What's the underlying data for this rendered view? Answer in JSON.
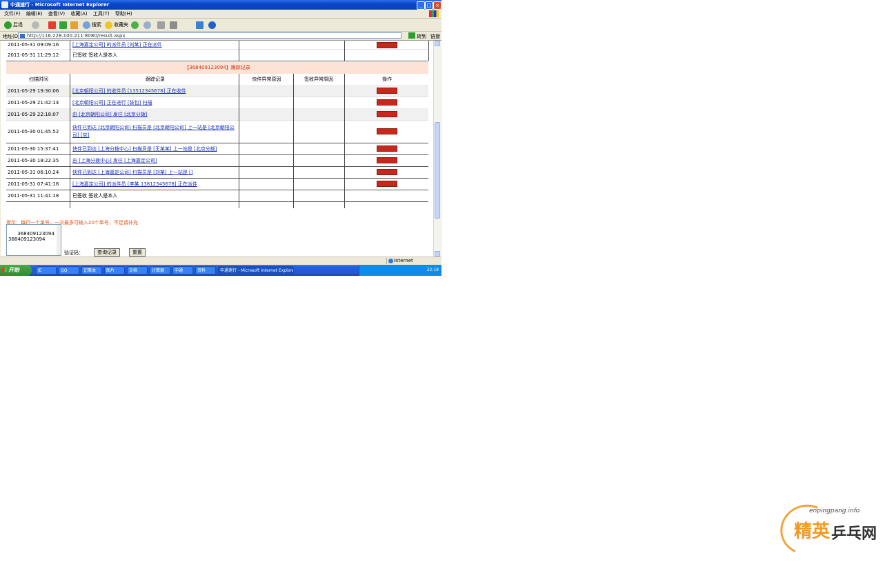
{
  "window": {
    "title": "中通速行 - Microsoft Internet Explorer",
    "controls": [
      "_",
      "□",
      "×"
    ]
  },
  "menu": [
    "文件(F)",
    "编辑(E)",
    "查看(V)",
    "收藏(A)",
    "工具(T)",
    "帮助(H)"
  ],
  "toolbar": {
    "back": "后退",
    "search": "搜索",
    "favorites": "收藏夹"
  },
  "address": {
    "label": "地址(D)",
    "url": "http://116.228.100.211:8080/result.aspx",
    "go": "转到",
    "links": "链接"
  },
  "top_rows": [
    {
      "time": "2011-05-31 09:09:16",
      "text": "[上海嘉定公司] 的派件员 [刘某] 正在派件"
    },
    {
      "time": "2011-05-31 11:29:12",
      "text": "已签收 签收人是本人"
    }
  ],
  "section_title": "【368409123094】跟踪记录",
  "headers": [
    "扫描时间",
    "跟踪记录",
    "快件异常原因",
    "签收异常原因",
    "操作"
  ],
  "rows": [
    {
      "time": "2011-05-29 19:30:06",
      "text": "[北京朝阳公司] 的收件员 [13512345678] 正在收件",
      "btn": "查看"
    },
    {
      "time": "2011-05-29 21:42:14",
      "text": "[北京朝阳公司] 正在进行 [装包] 扫描",
      "btn": "查看"
    },
    {
      "time": "2011-05-29 22:18:07",
      "text": "由 [北京朝阳公司] 发往 [北京分拨]",
      "btn": "查看"
    },
    {
      "time": "2011-05-30 01:45:52",
      "text": "快件已到达 [北京朝阳公司] 扫描员是 [北京朝阳公司] 上一站是 [北京朝阳公司] [空]",
      "btn": "查看"
    },
    {
      "time": "2011-05-30 15:37:41",
      "text": "快件已到达 [上海分拨中心] 扫描员是 [王某某] 上一站是 [北京分拨]",
      "btn": "查看"
    },
    {
      "time": "2011-05-30 18:22:35",
      "text": "由 [上海分拨中心] 发往 [上海嘉定公司]",
      "btn": "查看"
    },
    {
      "time": "2011-05-31 06:10:24",
      "text": "快件已到达 [上海嘉定公司] 扫描员是 [刘某] 上一站是 []",
      "btn": "查看"
    },
    {
      "time": "2011-05-31 07:41:16",
      "text": "[上海嘉定公司] 的派件员 [李某 13812345678] 正在派件",
      "btn": "查看"
    },
    {
      "time": "2011-05-31 11:41:18",
      "text": "已签收 签收人是本人",
      "btn": ""
    }
  ],
  "note": "提示：每行一个单号，一次最多可输入20个单号，不足请补充",
  "textarea": "368409123094\n368409123094",
  "bottom": {
    "label": "验证码：",
    "submit": "查询记录",
    "reset": "重置"
  },
  "status": {
    "zone": "Internet"
  },
  "taskbar": {
    "start": "开始",
    "tasks": [
      "IE",
      "QQ",
      "记事本",
      "图片",
      "文档",
      "计算器",
      "中通",
      "资料",
      "搜索"
    ],
    "active_task": "中通速行 - Microsoft Internet Explorer",
    "clock": "22:18"
  },
  "watermark": {
    "url": "enpingpang.info",
    "brand_1": "精英",
    "brand_2": "乒乓网"
  },
  "colors": {
    "section_bg": "#fde3d6",
    "section_text": "#d03010",
    "button_red": "#c8281c",
    "link": "#1a2fbf"
  }
}
